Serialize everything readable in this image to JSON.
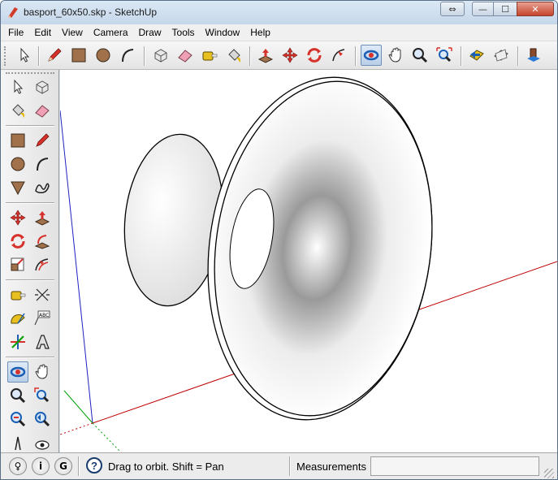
{
  "window": {
    "title": "basport_60x50.skp - SketchUp",
    "controls": {
      "restore_glyph": "⇔",
      "minimize_glyph": "—",
      "maximize_glyph": "☐",
      "close_glyph": "✕"
    }
  },
  "menu": {
    "items": [
      "File",
      "Edit",
      "View",
      "Camera",
      "Draw",
      "Tools",
      "Window",
      "Help"
    ]
  },
  "toolbars": {
    "top": [
      "select-icon",
      "pencil-icon",
      "rectangle-icon",
      "circle-icon",
      "arc-icon",
      "make-component-icon",
      "eraser-icon",
      "tape-measure-icon",
      "paint-bucket-icon",
      "push-pull-icon",
      "move-icon",
      "rotate-icon",
      "follow-me-icon",
      "orbit-icon",
      "pan-icon",
      "zoom-icon",
      "zoom-extents-icon",
      "previous-view-icon",
      "next-view-icon",
      "get-models-icon"
    ],
    "left": [
      "select-icon",
      "make-component-icon",
      "paint-bucket-icon",
      "eraser-icon",
      "rectangle-icon",
      "line-icon",
      "circle-icon",
      "arc-icon",
      "polygon-icon",
      "freehand-icon",
      "move-icon",
      "push-pull-icon",
      "rotate-icon",
      "follow-me-icon",
      "scale-icon",
      "offset-icon",
      "tape-measure-icon",
      "dimension-icon",
      "protractor-icon",
      "text-icon",
      "axes-icon",
      "3d-text-icon",
      "orbit-icon",
      "pan-icon",
      "zoom-icon",
      "zoom-window-icon",
      "zoom-extents-icon",
      "previous-view-icon"
    ],
    "active_tool": "orbit-icon"
  },
  "status": {
    "text": "Drag to orbit.  Shift = Pan",
    "measurements_label": "Measurements",
    "measurements_value": "",
    "help_glyph": "?",
    "info_icons": [
      {
        "name": "geo-location-icon",
        "glyph": "♀"
      },
      {
        "name": "credits-icon",
        "glyph": "i"
      },
      {
        "name": "account-icon",
        "glyph": "G"
      }
    ]
  },
  "colors": {
    "red_axis": "#c00000",
    "green_axis": "#00a000",
    "blue_axis": "#2020c0",
    "active_tool_bg": "#b9cfe8"
  }
}
